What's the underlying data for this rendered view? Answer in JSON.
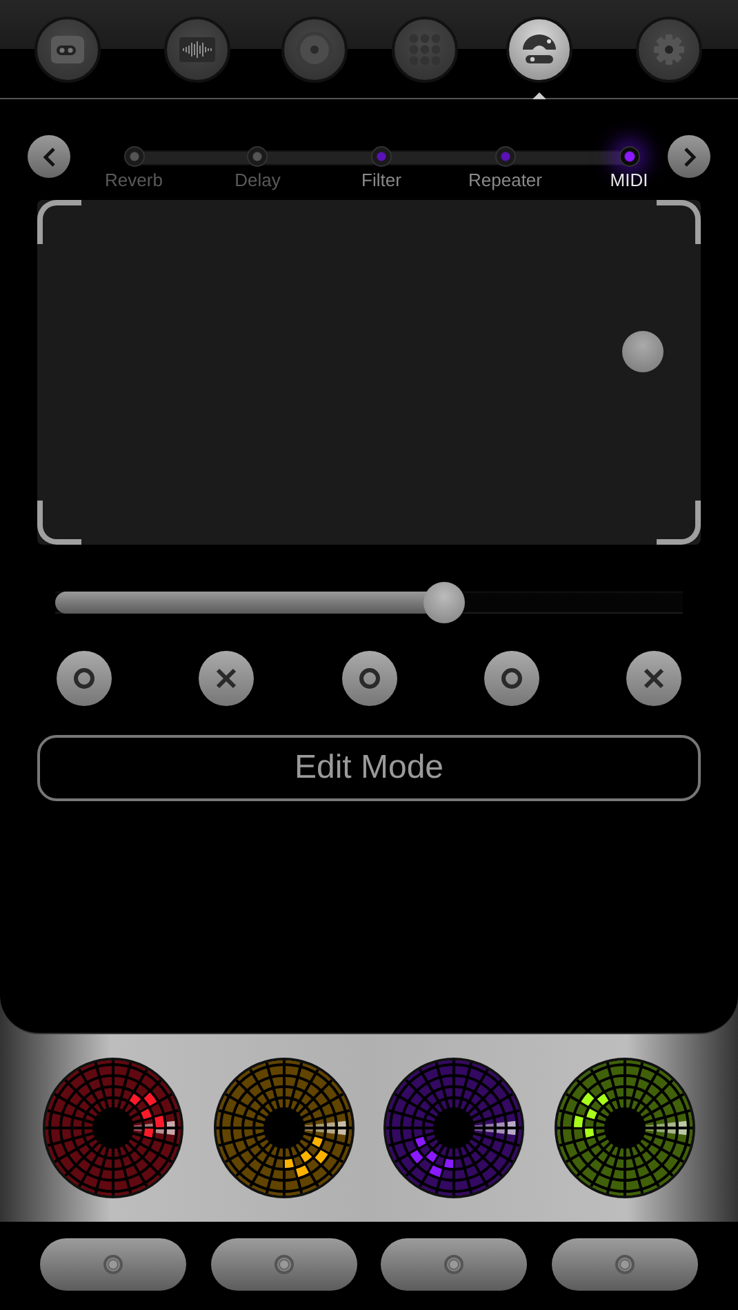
{
  "tabs": [
    {
      "selected": false
    },
    {
      "selected": false
    },
    {
      "selected": false
    },
    {
      "selected": false
    },
    {
      "selected": true
    },
    {
      "selected": false
    }
  ],
  "effects": [
    {
      "label": "Reverb",
      "enabled": false,
      "selected": false
    },
    {
      "label": "Delay",
      "enabled": false,
      "selected": false
    },
    {
      "label": "Filter",
      "enabled": true,
      "selected": false
    },
    {
      "label": "Repeater",
      "enabled": true,
      "selected": false
    },
    {
      "label": "MIDI",
      "enabled": true,
      "selected": true
    }
  ],
  "slider": {
    "level": 0.62
  },
  "toggles": [
    {
      "kind": "circle"
    },
    {
      "kind": "cross"
    },
    {
      "kind": "circle"
    },
    {
      "kind": "circle"
    },
    {
      "kind": "cross"
    }
  ],
  "edit_button": "Edit Mode",
  "pads": [
    {
      "color": "#ff1a2a"
    },
    {
      "color": "#ffb300"
    },
    {
      "color": "#8a1aff"
    },
    {
      "color": "#a8ff1a"
    }
  ]
}
